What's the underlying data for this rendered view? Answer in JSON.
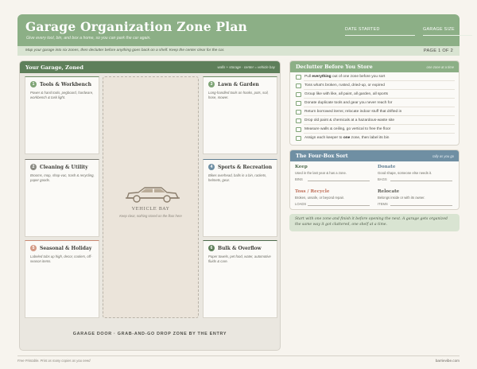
{
  "header": {
    "title": "Garage Organization Zone Plan",
    "subtitle": "Give every tool, bin, and box a home, so you can park the car again.",
    "date_label": "DATE STARTED",
    "size_label": "GARAGE SIZE"
  },
  "infobar": {
    "text": "Map your garage into six zones, then declutter before anything goes back on a shelf. Keep the center clear for the car.",
    "page": "PAGE 1 OF 2"
  },
  "zoned": {
    "title": "Your Garage, Zoned",
    "legend": "walls + storage · center = vehicle bay",
    "zones": [
      {
        "num": "1",
        "title": "Tools & Workbench",
        "desc": "Power & hand tools, pegboard, hardware, workbench & task light."
      },
      {
        "num": "2",
        "title": "Cleaning & Utility",
        "desc": "Brooms, mop, shop-vac, trash & recycling, paper goods."
      },
      {
        "num": "3",
        "title": "Lawn & Garden",
        "desc": "Long-handled tools on hooks, pots, soil, hose, mower."
      },
      {
        "num": "4",
        "title": "Sports & Recreation",
        "desc": "Bikes overhead, balls in a bin, rackets, helmets, gear."
      },
      {
        "num": "5",
        "title": "Seasonal & Holiday",
        "desc": "Labeled tubs up high, decor, coolers, off-season items."
      },
      {
        "num": "6",
        "title": "Bulk & Overflow",
        "desc": "Paper towels, pet food, water, automotive fluids & care."
      }
    ],
    "vehicle_bay": "VEHICLE BAY",
    "vehicle_sub": "Keep clear, nothing stored on the floor here",
    "door": "GARAGE DOOR · GRAB-AND-GO DROP ZONE BY THE ENTRY",
    "icons": {
      "car": "car-icon"
    }
  },
  "declutter": {
    "title": "Declutter Before You Store",
    "note": "one zone at a time",
    "items": [
      {
        "pre": "Pull ",
        "bold": "everything",
        "post": " out of one zone before you sort"
      },
      {
        "pre": "Toss what's broken, rusted, dried-up, or expired",
        "bold": "",
        "post": ""
      },
      {
        "pre": "Group like with like, all paint, all garden, all sports",
        "bold": "",
        "post": ""
      },
      {
        "pre": "Donate duplicate tools and gear you never reach for",
        "bold": "",
        "post": ""
      },
      {
        "pre": "Return borrowed items; relocate indoor stuff that drifted in",
        "bold": "",
        "post": ""
      },
      {
        "pre": "Drop old paint & chemicals at a hazardous-waste site",
        "bold": "",
        "post": ""
      },
      {
        "pre": "Measure walls & ceiling, go vertical to free the floor",
        "bold": "",
        "post": ""
      },
      {
        "pre": "Assign each keeper to ",
        "bold": "one",
        "post": " zone, then label its bin"
      }
    ]
  },
  "foursort": {
    "title": "The Four-Box Sort",
    "note": "tally as you go",
    "boxes": [
      {
        "name": "Keep",
        "desc": "Used in the last year & has a zone.",
        "field": "BINS"
      },
      {
        "name": "Donate",
        "desc": "Good shape, someone else needs it.",
        "field": "BAGS"
      },
      {
        "name": "Toss / Recycle",
        "desc": "Broken, unsafe, or beyond repair.",
        "field": "LOADS"
      },
      {
        "name": "Relocate",
        "desc": "Belongs inside or with its owner.",
        "field": "ITEMS"
      }
    ]
  },
  "tip": "Start with one zone and finish it before opening the next. A garage gets organized the same way it got cluttered, one shelf at a time.",
  "footer": {
    "left": "Free Printable. Print as many copies as you need",
    "right": "barrievibe.com"
  },
  "colors": {
    "accent_green": "#8caf86",
    "dark_green": "#5e7f5a",
    "blue": "#6f8fa3",
    "terracotta": "#c98872",
    "paper": "#f7f4ee"
  }
}
